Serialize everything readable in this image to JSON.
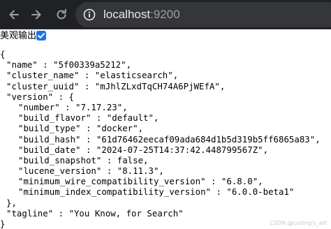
{
  "browser": {
    "url_host": "localhost",
    "url_port": ":9200"
  },
  "prettyprint": {
    "label": "美观输出",
    "checked": true
  },
  "json_lines": {
    "open": "{",
    "name": "\"name\" : \"5f00339a5212\",",
    "cluster_name": "\"cluster_name\" : \"elasticsearch\",",
    "cluster_uuid": "\"cluster_uuid\" : \"mJhlZLxdTqCH74A6PjWEfA\",",
    "version_open": "\"version\" : {",
    "number": "\"number\" : \"7.17.23\",",
    "build_flavor": "\"build_flavor\" : \"default\",",
    "build_type": "\"build_type\" : \"docker\",",
    "build_hash": "\"build_hash\" : \"61d76462eecaf09ada684d1b5d319b5ff6865a83\",",
    "build_date": "\"build_date\" : \"2024-07-25T14:37:42.448799567Z\",",
    "build_snapshot": "\"build_snapshot\" : false,",
    "lucene_version": "\"lucene_version\" : \"8.11.3\",",
    "min_wire": "\"minimum_wire_compatibility_version\" : \"6.8.0\",",
    "min_index": "\"minimum_index_compatibility_version\" : \"6.0.0-beta1\"",
    "version_close": "},",
    "tagline": "\"tagline\" : \"You Know, for Search\"",
    "close": "}"
  },
  "watermark": "CSDN @coding's_art",
  "icons": {
    "back": "arrow-left-icon",
    "forward": "arrow-right-icon",
    "reload": "reload-icon",
    "site_info": "site-info-icon",
    "checkbox": "checkmark-icon"
  }
}
